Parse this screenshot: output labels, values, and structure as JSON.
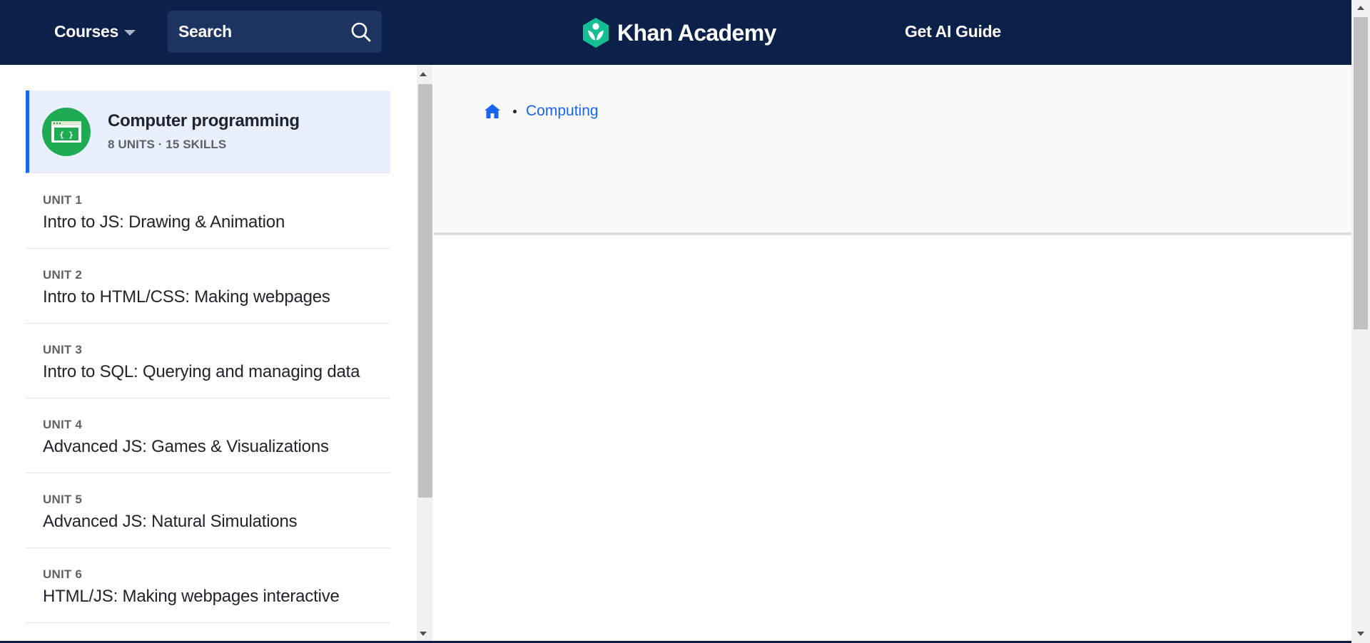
{
  "header": {
    "courses_label": "Courses",
    "search_label": "Search",
    "logo_text": "Khan Academy",
    "ai_guide_label": "Get AI Guide"
  },
  "sidebar": {
    "course": {
      "title": "Computer programming",
      "meta": "8 UNITS · 15 SKILLS",
      "icon_glyph": "{}",
      "icon_color": "#1fab54"
    },
    "units": [
      {
        "number": "UNIT 1",
        "title": "Intro to JS: Drawing & Animation"
      },
      {
        "number": "UNIT 2",
        "title": "Intro to HTML/CSS: Making webpages"
      },
      {
        "number": "UNIT 3",
        "title": "Intro to SQL: Querying and managing data"
      },
      {
        "number": "UNIT 4",
        "title": "Advanced JS: Games & Visualizations"
      },
      {
        "number": "UNIT 5",
        "title": "Advanced JS: Natural Simulations"
      },
      {
        "number": "UNIT 6",
        "title": "HTML/JS: Making webpages interactive"
      }
    ]
  },
  "main": {
    "breadcrumb": {
      "home_icon": "home-icon",
      "link": "Computing"
    }
  },
  "colors": {
    "header_bg": "#0b2149",
    "accent": "#1865f2",
    "logo_green": "#14bf96",
    "selected_bg": "#e9f0fd"
  }
}
